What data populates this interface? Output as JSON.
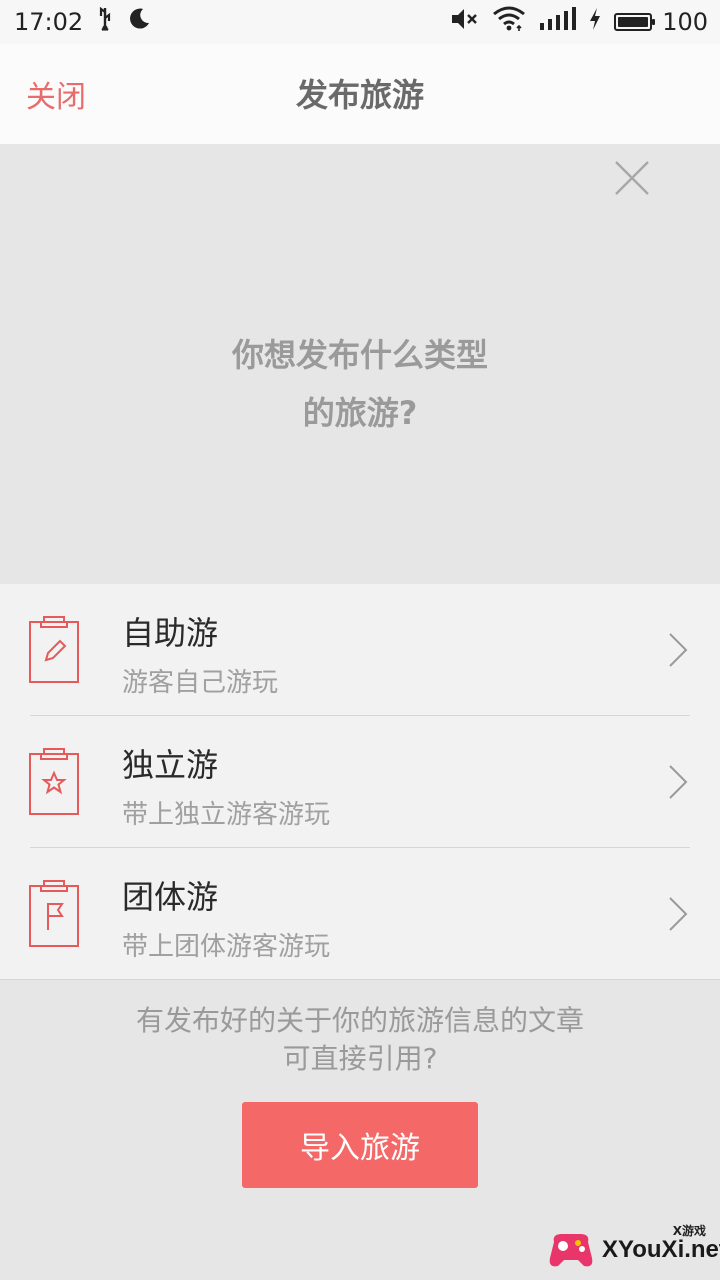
{
  "status_bar": {
    "time": "17:02",
    "battery_level": "100",
    "battery_fraction": 1.0,
    "icons": [
      "usb-icon",
      "moon-icon",
      "mute-icon",
      "wifi-icon",
      "signal-icon",
      "charging-icon",
      "battery-icon"
    ]
  },
  "nav": {
    "close_label": "关闭",
    "title": "发布旅游"
  },
  "hero": {
    "question_line1": "你想发布什么类型",
    "question_line2": "的旅游?"
  },
  "options": [
    {
      "title": "自助游",
      "subtitle": "游客自己游玩",
      "icon": "clipboard-pencil-icon"
    },
    {
      "title": "独立游",
      "subtitle": "带上独立游客游玩",
      "icon": "clipboard-star-icon"
    },
    {
      "title": "团体游",
      "subtitle": "带上团体游客游玩",
      "icon": "clipboard-flag-icon"
    }
  ],
  "footer": {
    "line1": "有发布好的关于你的旅游信息的文章",
    "line2": "可直接引用?",
    "import_button": "导入旅游"
  },
  "watermark": {
    "small": "X游戏",
    "main": "XYouXi.net"
  },
  "colors": {
    "accent": "#f46868",
    "close_text": "#e86c6c",
    "icon_stroke": "#e55a5a",
    "background": "#e6e6e6",
    "list_background": "#f2f2f2"
  }
}
